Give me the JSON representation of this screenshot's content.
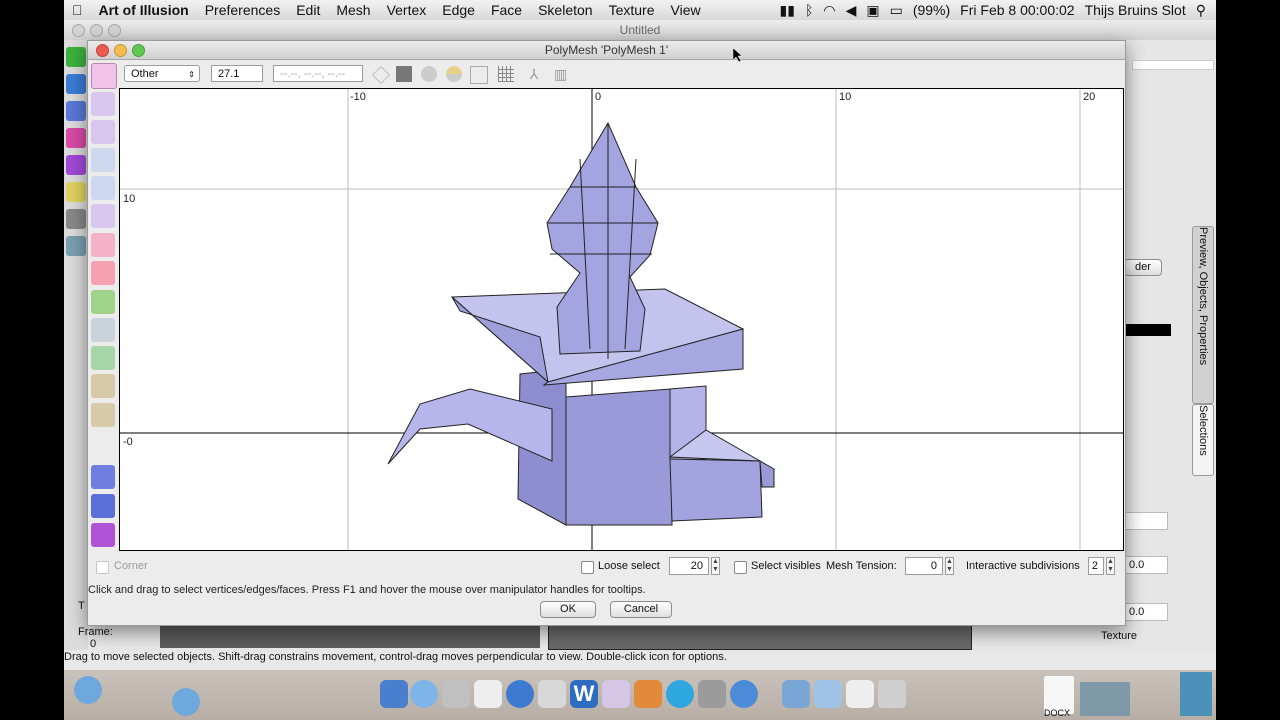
{
  "menubar": {
    "apple": "",
    "app_name": "Art of Illusion",
    "items": [
      "Preferences",
      "Edit",
      "Mesh",
      "Vertex",
      "Edge",
      "Face",
      "Skeleton",
      "Texture",
      "View"
    ],
    "battery": "(99%)",
    "clock": "Fri Feb 8  00:00:02",
    "user": "Thijs Bruins Slot"
  },
  "main_window": {
    "title": "Untitled",
    "status_text": "Drag to move selected objects.  Shift-drag constrains movement, control-drag moves perpendicular to view.  Double-click icon for options.",
    "frame_label": "Frame:",
    "frame_value": "0",
    "t_label": "T",
    "right_tabs": [
      "Preview, Objects, Properties",
      "Selections"
    ],
    "right_button_fragment": "der",
    "right_values": [
      "0.0",
      "0.0"
    ],
    "texture_label": "Texture"
  },
  "dialog": {
    "title": "PolyMesh 'PolyMesh 1'",
    "view_select": "Other",
    "zoom_value": "27.1",
    "coord_placeholder": "--.--, --.--, --.--",
    "ruler_top": [
      "-10",
      "0",
      "10",
      "20"
    ],
    "ruler_left": [
      "10",
      "-0"
    ],
    "options": {
      "corner_label": "Corner",
      "loose_select_label": "Loose select",
      "loose_select_value": "20",
      "select_visibles_label": "Select visibles",
      "mesh_tension_label": "Mesh Tension:",
      "mesh_tension_value": "0",
      "interactive_subdivisions_label": "Interactive subdivisions",
      "interactive_subdivisions_value": "2"
    },
    "help_text": "Click and drag to select vertices/edges/faces. Press F1 and hover the mouse over manipulator handles for tooltips.",
    "ok_label": "OK",
    "cancel_label": "Cancel"
  },
  "dock": {
    "docx_label": "DOCX"
  }
}
